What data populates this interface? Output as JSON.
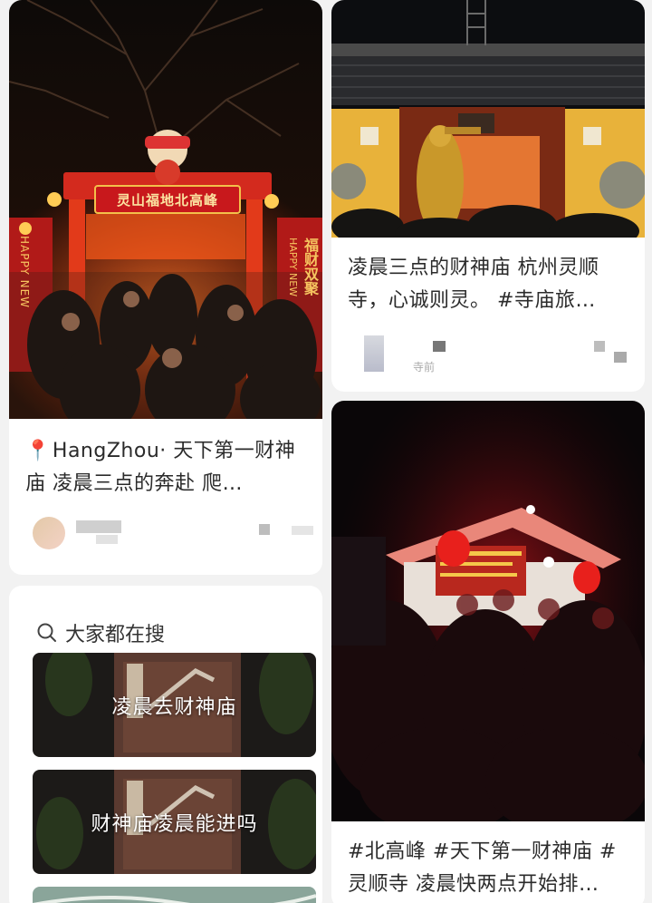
{
  "colors": {
    "background": "#f2f2f2",
    "card": "#ffffff",
    "temple_red": "#c8181c",
    "gold": "#e8b23a"
  },
  "cards": [
    {
      "title_prefix_icon": "location-pin-icon",
      "title": "HangZhou· 天下第一财神庙 凌晨三点的奔赴 爬…",
      "image_gate_sign": "灵山福地北高峰",
      "image_banner_left": "HAPPY NEW",
      "image_banner_right": "福财双聚",
      "image_banner_right_en": "HAPPY NEW"
    },
    {
      "title": "凌晨三点的财神庙 杭州灵顺寺，心诚则灵。 #寺庙旅…",
      "author_partial": "寺前"
    },
    {
      "title": "#北高峰 #天下第一财神庙 #灵顺寺 凌晨快两点开始排…"
    }
  ],
  "search_panel": {
    "icon": "search-icon",
    "heading": "大家都在搜",
    "chips": [
      {
        "label": "凌晨去财神庙"
      },
      {
        "label": "财神庙凌晨能进吗"
      }
    ]
  }
}
